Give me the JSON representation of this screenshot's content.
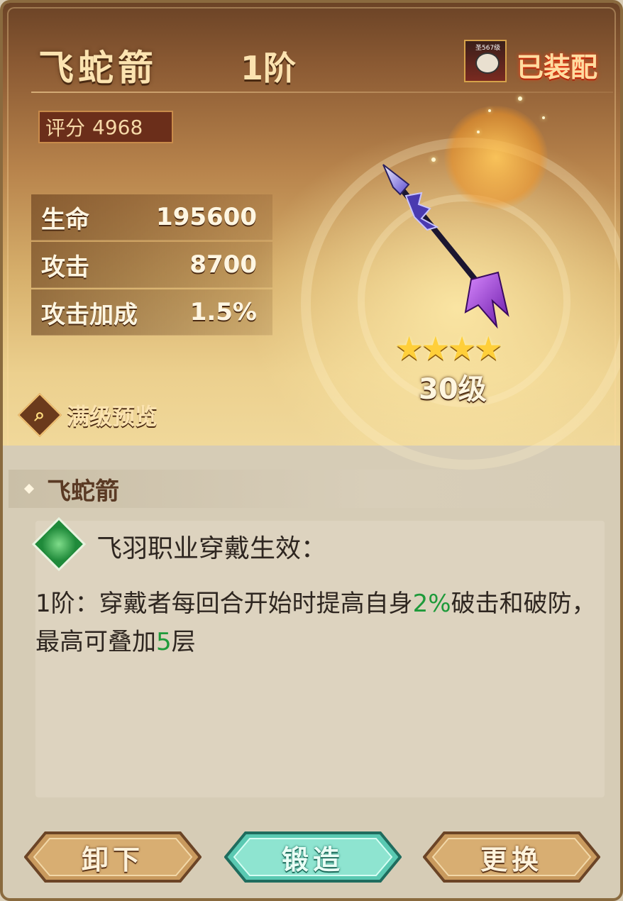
{
  "item": {
    "name": "飞蛇箭",
    "grade": "1阶",
    "equipped_label": "已装配",
    "equipped_hero_level": "圣567级",
    "score_label": "评分",
    "score_value": "4968",
    "stars": 4,
    "level": "30级"
  },
  "stats": [
    {
      "label": "生命",
      "value": "195600"
    },
    {
      "label": "攻击",
      "value": "8700"
    },
    {
      "label": "攻击加成",
      "value": "1.5%"
    }
  ],
  "preview_label": "满级预览",
  "description": {
    "section_title": "飞蛇箭",
    "skill_header": "飞羽职业穿戴生效：",
    "line_prefix": "1阶：穿戴者每回合开始时提高自身",
    "value_1": "2%",
    "line_middle": "破击和破防，最高可叠加",
    "value_2": "5",
    "line_suffix": "层"
  },
  "buttons": {
    "unequip": "卸下",
    "forge": "锻造",
    "replace": "更换"
  },
  "colors": {
    "highlight_green": "#1e9a3a",
    "equipped_red": "#ff3a10",
    "star_gold": "#ffcf3a"
  }
}
